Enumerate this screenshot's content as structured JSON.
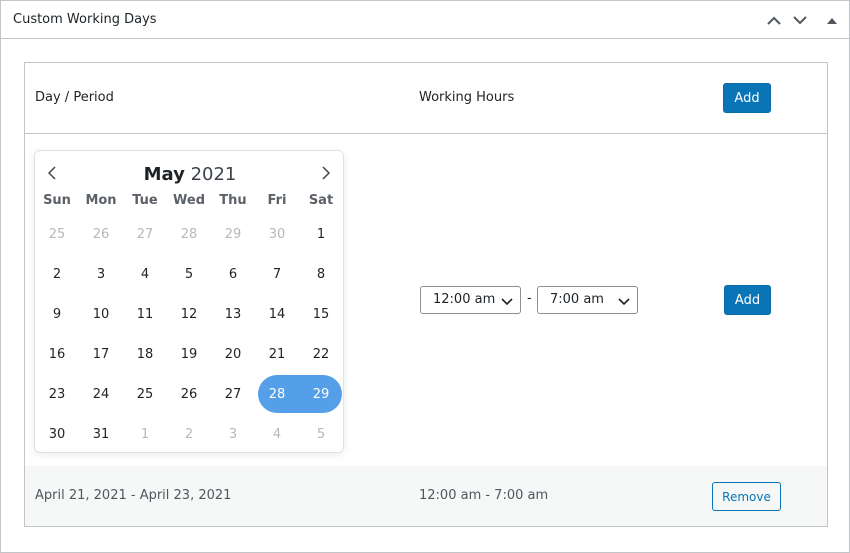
{
  "panel": {
    "title": "Custom Working Days",
    "controls": [
      {
        "name": "move-up-icon"
      },
      {
        "name": "move-down-icon"
      },
      {
        "name": "toggle-panel-icon"
      }
    ]
  },
  "table": {
    "headers": {
      "day_period": "Day / Period",
      "working_hours": "Working Hours"
    },
    "header_add_label": "Add",
    "new_row": {
      "start_time": "12:00 am",
      "separator": "-",
      "end_time": "7:00 am",
      "add_label": "Add"
    },
    "existing_rows": [
      {
        "period": "April 21, 2021 - April 23, 2021",
        "hours": "12:00 am - 7:00 am",
        "remove_label": "Remove"
      }
    ]
  },
  "calendar": {
    "month": "May",
    "year": "2021",
    "weekdays": [
      "Sun",
      "Mon",
      "Tue",
      "Wed",
      "Thu",
      "Fri",
      "Sat"
    ],
    "weeks": [
      [
        "25",
        "26",
        "27",
        "28",
        "29",
        "30",
        "1"
      ],
      [
        "2",
        "3",
        "4",
        "5",
        "6",
        "7",
        "8"
      ],
      [
        "9",
        "10",
        "11",
        "12",
        "13",
        "14",
        "15"
      ],
      [
        "16",
        "17",
        "18",
        "19",
        "20",
        "21",
        "22"
      ],
      [
        "23",
        "24",
        "25",
        "26",
        "27",
        "28",
        "29"
      ],
      [
        "30",
        "31",
        "1",
        "2",
        "3",
        "4",
        "5"
      ]
    ],
    "outside_month": [
      [
        0,
        0
      ],
      [
        0,
        1
      ],
      [
        0,
        2
      ],
      [
        0,
        3
      ],
      [
        0,
        4
      ],
      [
        0,
        5
      ],
      [
        5,
        2
      ],
      [
        5,
        3
      ],
      [
        5,
        4
      ],
      [
        5,
        5
      ],
      [
        5,
        6
      ]
    ],
    "selected": [
      [
        4,
        5
      ],
      [
        4,
        6
      ]
    ]
  },
  "colors": {
    "primary": "#0a75b6",
    "selection": "#549fe8",
    "muted_day": "#b5b8bc",
    "border": "#c3c4c7"
  }
}
